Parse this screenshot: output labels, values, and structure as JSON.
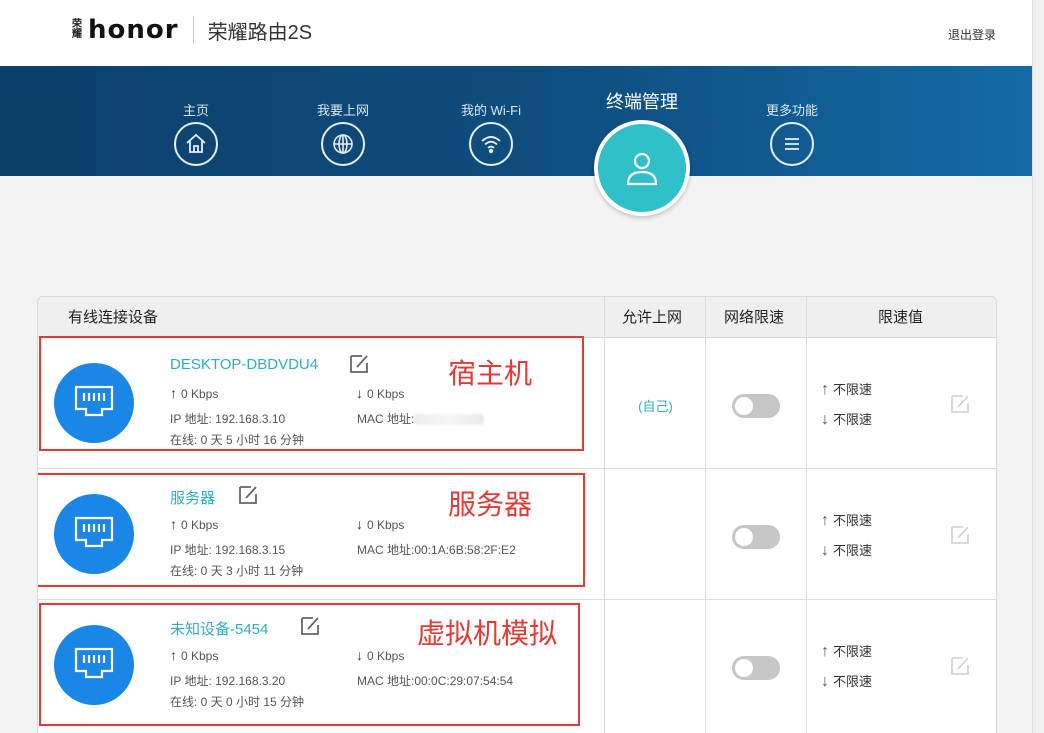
{
  "header": {
    "logo_badge": "荣耀",
    "logo_word": "honor",
    "product_name": "荣耀路由2S",
    "logout": "退出登录"
  },
  "nav": {
    "items": [
      {
        "label": "主页",
        "icon": "home-icon"
      },
      {
        "label": "我要上网",
        "icon": "globe-icon"
      },
      {
        "label": "我的 Wi-Fi",
        "icon": "wifi-icon"
      },
      {
        "label": "更多功能",
        "icon": "menu-icon"
      }
    ],
    "active": {
      "label": "终端管理",
      "icon": "user-icon"
    }
  },
  "table": {
    "headers": [
      "有线连接设备",
      "允许上网",
      "网络限速",
      "限速值"
    ],
    "rows": [
      {
        "name": "DESKTOP-DBDVDU4",
        "up": "0 Kbps",
        "down": "0 Kbps",
        "ip": "IP 地址: 192.168.3.10",
        "mac": "MAC 地址:",
        "online": "在线: 0 天 5 小时 16 分钟",
        "allow": "(自己)",
        "limit_up": "不限速",
        "limit_down": "不限速",
        "annotation": "宿主机"
      },
      {
        "name": "服务器",
        "up": "0 Kbps",
        "down": "0 Kbps",
        "ip": "IP 地址: 192.168.3.15",
        "mac": "MAC 地址:00:1A:6B:58:2F:E2",
        "online": "在线: 0 天 3 小时 11 分钟",
        "allow": "",
        "limit_up": "不限速",
        "limit_down": "不限速",
        "annotation": "服务器"
      },
      {
        "name": "未知设备-5454",
        "up": "0 Kbps",
        "down": "0 Kbps",
        "ip": "IP 地址: 192.168.3.20",
        "mac": "MAC 地址:00:0C:29:07:54:54",
        "online": "在线: 0 天 0 小时 15 分钟",
        "allow": "",
        "limit_up": "不限速",
        "limit_down": "不限速",
        "annotation": "虚拟机模拟"
      }
    ]
  },
  "colors": {
    "accent_teal": "#2cafc0",
    "device_blue": "#1a86e6",
    "nav_band": "#0f4e80",
    "annotation_red": "#e53935"
  }
}
